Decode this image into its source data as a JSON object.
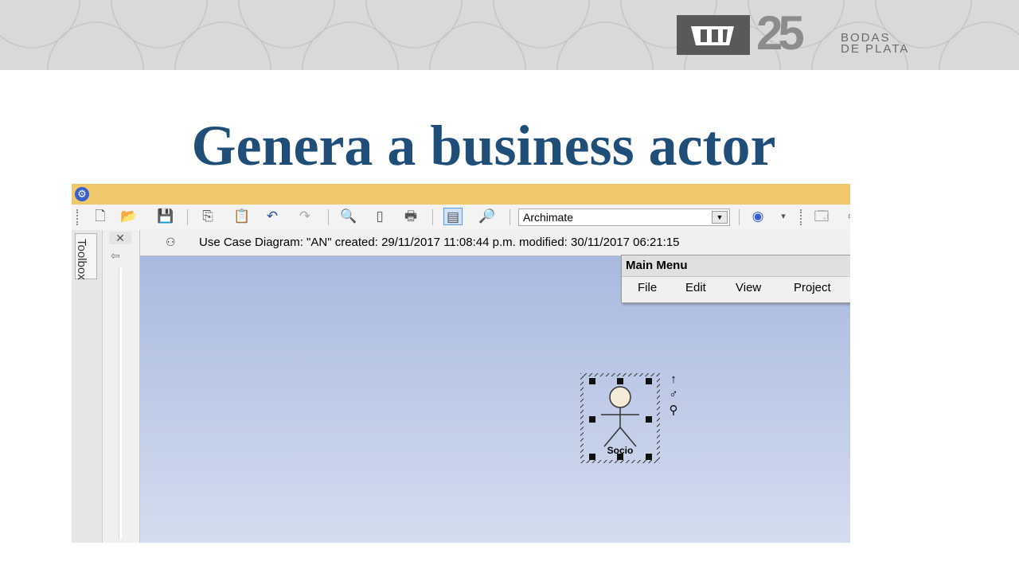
{
  "slide": {
    "title": "Genera a business actor",
    "logo": {
      "number": "25",
      "text_line1": "BODAS",
      "text_line2": "DE PLATA"
    }
  },
  "window": {
    "toolbar": {
      "perspective_value": "Archimate"
    },
    "toolbox_label": "Toolbox",
    "diagram_info": "Use Case Diagram: \"AN\"   created: 29/11/2017 11:08:44 p.m.  modified: 30/11/2017 06:21:15",
    "main_menu": {
      "title": "Main Menu",
      "items": [
        "File",
        "Edit",
        "View",
        "Project"
      ]
    },
    "actor": {
      "label": "Socio"
    }
  },
  "colors": {
    "title": "#1f4e79",
    "titlebar": "#f0c86c",
    "canvas_top": "#a9b9df",
    "canvas_bottom": "#d4dcef"
  },
  "icons": [
    "new-diagram-icon",
    "open-folder-icon",
    "save-icon",
    "copy-icon",
    "paste-icon",
    "undo-icon",
    "redo-icon",
    "print-preview-icon",
    "page-setup-icon",
    "print-icon",
    "diagram-properties-icon",
    "find-icon",
    "help-icon",
    "settings-icon"
  ]
}
